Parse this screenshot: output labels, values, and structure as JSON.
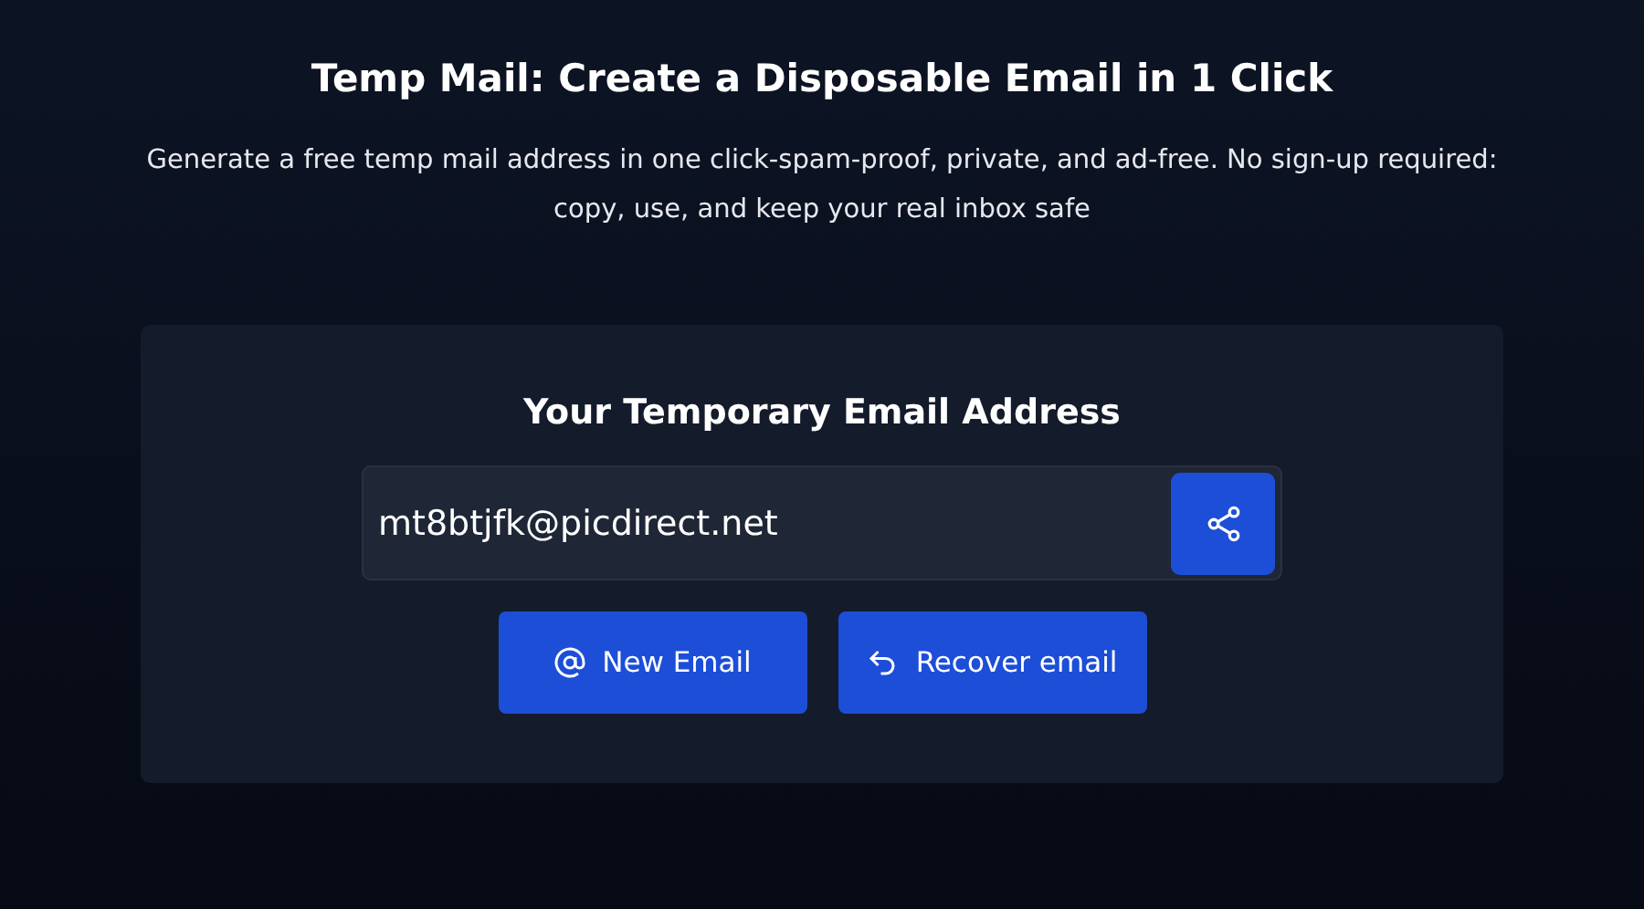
{
  "header": {
    "title": "Temp Mail: Create a Disposable Email in 1 Click",
    "subtitle": "Generate a free temp mail address in one click-spam-proof, private, and ad-free. No sign-up required: copy, use, and keep your real inbox safe"
  },
  "card": {
    "title": "Your Temporary Email Address",
    "email": {
      "value": "mt8btjfk@picdirect.net"
    },
    "buttons": [
      {
        "kind": "new",
        "label": "New Email"
      },
      {
        "kind": "recover",
        "label": "Recover email"
      }
    ]
  }
}
